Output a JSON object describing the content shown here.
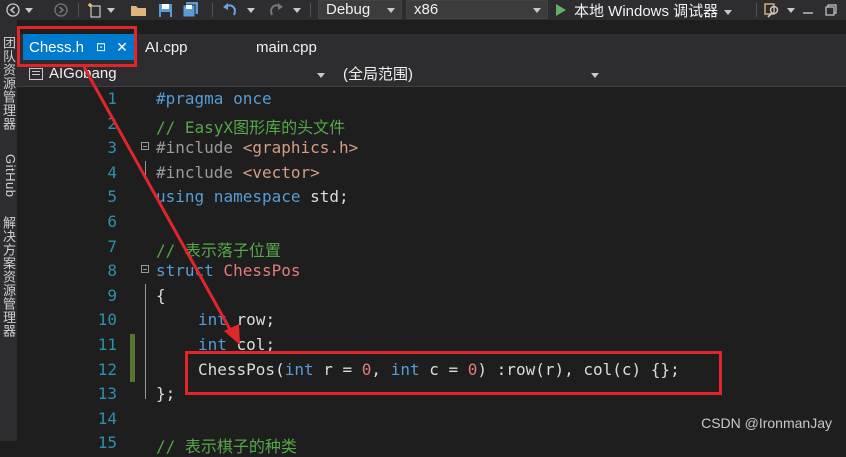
{
  "toolbar": {
    "configuration": "Debug",
    "platform": "x86",
    "run_label": "本地 Windows 调试器",
    "icons": [
      "back-icon",
      "forward-icon",
      "new-item-icon",
      "open-folder-icon",
      "save-icon",
      "save-all-icon",
      "undo-icon",
      "redo-icon",
      "find-icon",
      "minimize-icon",
      "restore-icon"
    ]
  },
  "left_strip": {
    "labels": [
      "团队资源管理器",
      "GitHub",
      "解决方案资源管理器"
    ]
  },
  "tabs": [
    {
      "label": "Chess.h",
      "active": true
    },
    {
      "label": "AI.cpp",
      "active": false
    },
    {
      "label": "main.cpp",
      "active": false
    }
  ],
  "navbar": {
    "class_scope": "AIGobang",
    "member_scope": "(全局范围)"
  },
  "code_lines": [
    {
      "n": "1",
      "text": "#pragma once"
    },
    {
      "n": "2",
      "text": "// EasyX图形库的头文件"
    },
    {
      "n": "3",
      "text": "#include <graphics.h>"
    },
    {
      "n": "4",
      "text": "#include <vector>"
    },
    {
      "n": "5",
      "text": "using namespace std;"
    },
    {
      "n": "6",
      "text": ""
    },
    {
      "n": "7",
      "text": "// 表示落子位置"
    },
    {
      "n": "8",
      "text": "struct ChessPos"
    },
    {
      "n": "9",
      "text": "{"
    },
    {
      "n": "10",
      "text": "int row;"
    },
    {
      "n": "11",
      "text": "int col;"
    },
    {
      "n": "12",
      "text": "ChessPos(int r = 0, int c = 0) :row(r), col(c) {};"
    },
    {
      "n": "13",
      "text": "};"
    },
    {
      "n": "14",
      "text": ""
    },
    {
      "n": "15",
      "text": "// 表示棋子的种类"
    }
  ],
  "tokens": {
    "l1a": "#pragma",
    "l1b": " once",
    "l2": "// EasyX图形库的头文件",
    "l3a": "#include",
    "l3b": " <graphics.h>",
    "l4a": "#include",
    "l4b": " <vector>",
    "l5a": "using",
    "l5b": " namespace",
    "l5c": " std;",
    "l7": "// 表示落子位置",
    "l8a": "struct",
    "l8b": " ChessPos",
    "l9": "{",
    "l10a": "int",
    "l10b": " row;",
    "l11a": "int",
    "l11b": " col;",
    "l12a": "ChessPos",
    "l12b": "(",
    "l12c": "int",
    "l12d": " r = ",
    "l12e": "0",
    "l12f": ", ",
    "l12g": "int",
    "l12h": " c = ",
    "l12i": "0",
    "l12j": ") :row(r), col(c) {};",
    "l13": "};",
    "l15": "// 表示棋子的种类"
  },
  "watermark": "CSDN @IronmanJay",
  "colors": {
    "background": "#1e1e1e",
    "chrome": "#2d2d30",
    "active_tab": "#007acc",
    "line_number": "#2b91af",
    "keyword": "#569cd6",
    "comment": "#57a64a",
    "string": "#d69d85",
    "type": "#4ec9b0",
    "number": "#b5cea8",
    "annotation": "#e0262a"
  }
}
